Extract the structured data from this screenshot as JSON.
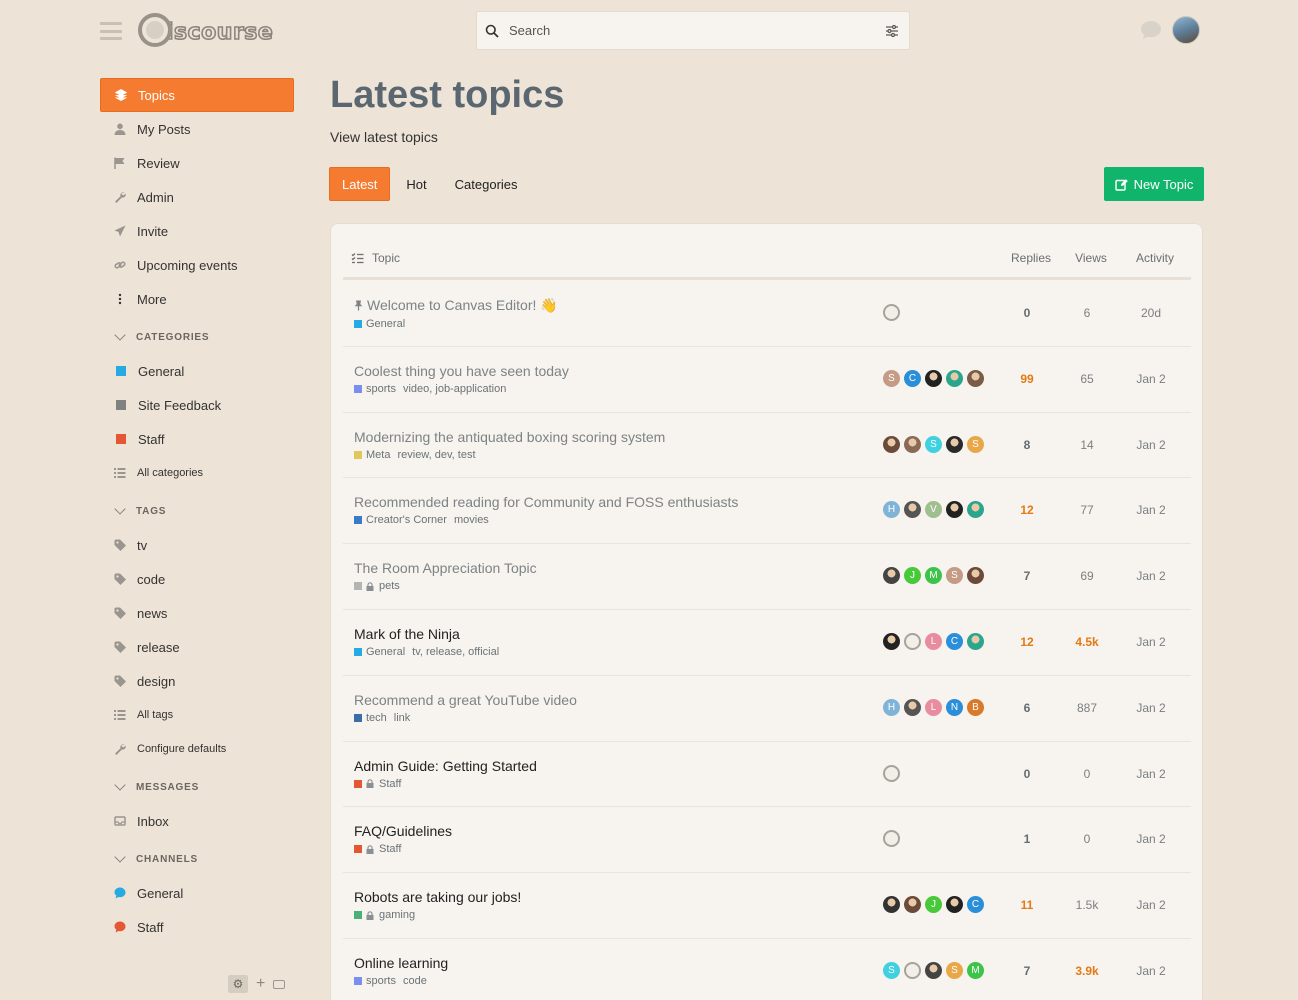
{
  "header": {
    "logo_text": "iscourse",
    "search_placeholder": "Search"
  },
  "sidebar": {
    "primary": [
      {
        "label": "Topics",
        "icon": "layers-icon",
        "active": true
      },
      {
        "label": "My Posts",
        "icon": "user-icon"
      },
      {
        "label": "Review",
        "icon": "flag-icon"
      },
      {
        "label": "Admin",
        "icon": "wrench-icon"
      },
      {
        "label": "Invite",
        "icon": "paper-plane-icon"
      },
      {
        "label": "Upcoming events",
        "icon": "link-icon"
      },
      {
        "label": "More",
        "icon": "ellipsis-vertical-icon"
      }
    ],
    "categories_heading": "CATEGORIES",
    "categories": [
      {
        "label": "General",
        "color": "#25aae1"
      },
      {
        "label": "Site Feedback",
        "color": "#808281"
      },
      {
        "label": "Staff",
        "color": "#e45735"
      }
    ],
    "all_categories": "All categories",
    "tags_heading": "TAGS",
    "tags": [
      "tv",
      "code",
      "news",
      "release",
      "design"
    ],
    "all_tags": "All tags",
    "configure_defaults": "Configure defaults",
    "messages_heading": "MESSAGES",
    "inbox": "Inbox",
    "channels_heading": "CHANNELS",
    "channels": [
      {
        "label": "General",
        "color": "#25aae1"
      },
      {
        "label": "Staff",
        "color": "#e45735"
      }
    ]
  },
  "main": {
    "title": "Latest topics",
    "subtitle": "View latest topics",
    "tabs": [
      {
        "label": "Latest",
        "active": true
      },
      {
        "label": "Hot"
      },
      {
        "label": "Categories"
      }
    ],
    "new_topic": "New Topic",
    "columns": {
      "topic": "Topic",
      "replies": "Replies",
      "views": "Views",
      "activity": "Activity"
    },
    "topics": [
      {
        "title": "Welcome to Canvas Editor! 👋",
        "pinned": true,
        "unread": false,
        "category": "General",
        "cat_color": "#25aae1",
        "locked": false,
        "tags": "",
        "posters": [
          {
            "type": "disc"
          }
        ],
        "replies": "0",
        "replies_hot": false,
        "views": "6",
        "views_hot": false,
        "activity": "20d"
      },
      {
        "title": "Coolest thing you have seen today",
        "unread": false,
        "category": "sports",
        "cat_color": "#7b8ef0",
        "locked": false,
        "tags": "video, job-application",
        "posters": [
          {
            "letter": "S",
            "color": "#c49b85"
          },
          {
            "letter": "C",
            "color": "#2a8fd8"
          },
          {
            "type": "img",
            "color": "#222"
          },
          {
            "type": "img",
            "color": "#2ca58d"
          },
          {
            "type": "img",
            "color": "#7a5c48"
          }
        ],
        "replies": "99",
        "replies_hot": true,
        "views": "65",
        "views_hot": false,
        "activity": "Jan 2"
      },
      {
        "title": "Modernizing the antiquated boxing scoring system",
        "unread": false,
        "category": "Meta",
        "cat_color": "#e0c85a",
        "locked": false,
        "tags": "review, dev, test",
        "posters": [
          {
            "type": "img",
            "color": "#6b4a3a"
          },
          {
            "type": "img",
            "color": "#8a6a55"
          },
          {
            "letter": "S",
            "color": "#3fd1e0"
          },
          {
            "type": "img",
            "color": "#2a2a2a"
          },
          {
            "letter": "S",
            "color": "#e8a84a"
          }
        ],
        "replies": "8",
        "replies_hot": false,
        "views": "14",
        "views_hot": false,
        "activity": "Jan 2"
      },
      {
        "title": "Recommended reading for Community and FOSS enthusiasts",
        "unread": false,
        "category": "Creator's Corner",
        "cat_color": "#3a7bc8",
        "locked": false,
        "tags": "movies",
        "posters": [
          {
            "letter": "H",
            "color": "#7fb3d8"
          },
          {
            "type": "img",
            "color": "#555"
          },
          {
            "letter": "V",
            "color": "#9fbf8f"
          },
          {
            "type": "img",
            "color": "#222"
          },
          {
            "type": "img",
            "color": "#2ca58d"
          }
        ],
        "replies": "12",
        "replies_hot": true,
        "views": "77",
        "views_hot": false,
        "activity": "Jan 2"
      },
      {
        "title": "The Room Appreciation Topic",
        "unread": false,
        "category": "pets",
        "cat_color": "#b3b5b4",
        "locked": true,
        "tags": "",
        "posters": [
          {
            "type": "img",
            "color": "#444"
          },
          {
            "letter": "J",
            "color": "#48c93a"
          },
          {
            "letter": "M",
            "color": "#3cc44a"
          },
          {
            "letter": "S",
            "color": "#c49b85"
          },
          {
            "type": "img",
            "color": "#6b4a3a"
          }
        ],
        "replies": "7",
        "replies_hot": false,
        "views": "69",
        "views_hot": false,
        "activity": "Jan 2"
      },
      {
        "title": "Mark of the Ninja",
        "unread": true,
        "category": "General",
        "cat_color": "#25aae1",
        "locked": false,
        "tags": "tv, release, official",
        "posters": [
          {
            "type": "img",
            "color": "#222"
          },
          {
            "type": "disc"
          },
          {
            "letter": "L",
            "color": "#e88ca0"
          },
          {
            "letter": "C",
            "color": "#2a8fd8"
          },
          {
            "type": "img",
            "color": "#2ca58d"
          }
        ],
        "replies": "12",
        "replies_hot": true,
        "views": "4.5k",
        "views_hot": true,
        "activity": "Jan 2"
      },
      {
        "title": "Recommend a great YouTube video",
        "unread": false,
        "category": "tech",
        "cat_color": "#3a6ea8",
        "locked": false,
        "tags": "link",
        "posters": [
          {
            "letter": "H",
            "color": "#7fb3d8"
          },
          {
            "type": "img",
            "color": "#555"
          },
          {
            "letter": "L",
            "color": "#e88ca0"
          },
          {
            "letter": "N",
            "color": "#2a8fd8"
          },
          {
            "letter": "B",
            "color": "#d87a2a"
          }
        ],
        "replies": "6",
        "replies_hot": false,
        "views": "887",
        "views_hot": false,
        "activity": "Jan 2"
      },
      {
        "title": "Admin Guide: Getting Started",
        "unread": true,
        "category": "Staff",
        "cat_color": "#e45735",
        "locked": true,
        "tags": "",
        "posters": [
          {
            "type": "disc"
          }
        ],
        "replies": "0",
        "replies_hot": false,
        "views": "0",
        "views_hot": false,
        "activity": "Jan 2"
      },
      {
        "title": "FAQ/Guidelines",
        "unread": true,
        "category": "Staff",
        "cat_color": "#e45735",
        "locked": true,
        "tags": "",
        "posters": [
          {
            "type": "disc"
          }
        ],
        "replies": "1",
        "replies_hot": false,
        "views": "0",
        "views_hot": false,
        "activity": "Jan 2"
      },
      {
        "title": "Robots are taking our jobs!",
        "unread": true,
        "category": "gaming",
        "cat_color": "#4ab07a",
        "locked": true,
        "tags": "",
        "posters": [
          {
            "type": "img",
            "color": "#333"
          },
          {
            "type": "img",
            "color": "#6b4a3a"
          },
          {
            "letter": "J",
            "color": "#48c93a"
          },
          {
            "type": "img",
            "color": "#222"
          },
          {
            "letter": "C",
            "color": "#2a8fd8"
          }
        ],
        "replies": "11",
        "replies_hot": true,
        "views": "1.5k",
        "views_hot": false,
        "activity": "Jan 2"
      },
      {
        "title": "Online learning",
        "unread": true,
        "category": "sports",
        "cat_color": "#7b8ef0",
        "locked": false,
        "tags": "code",
        "posters": [
          {
            "letter": "S",
            "color": "#3fd1e0"
          },
          {
            "type": "disc"
          },
          {
            "type": "img",
            "color": "#444"
          },
          {
            "letter": "S",
            "color": "#e8a84a"
          },
          {
            "letter": "M",
            "color": "#3cc44a"
          }
        ],
        "replies": "7",
        "replies_hot": false,
        "views": "3.9k",
        "views_hot": true,
        "activity": "Jan 2"
      }
    ]
  }
}
